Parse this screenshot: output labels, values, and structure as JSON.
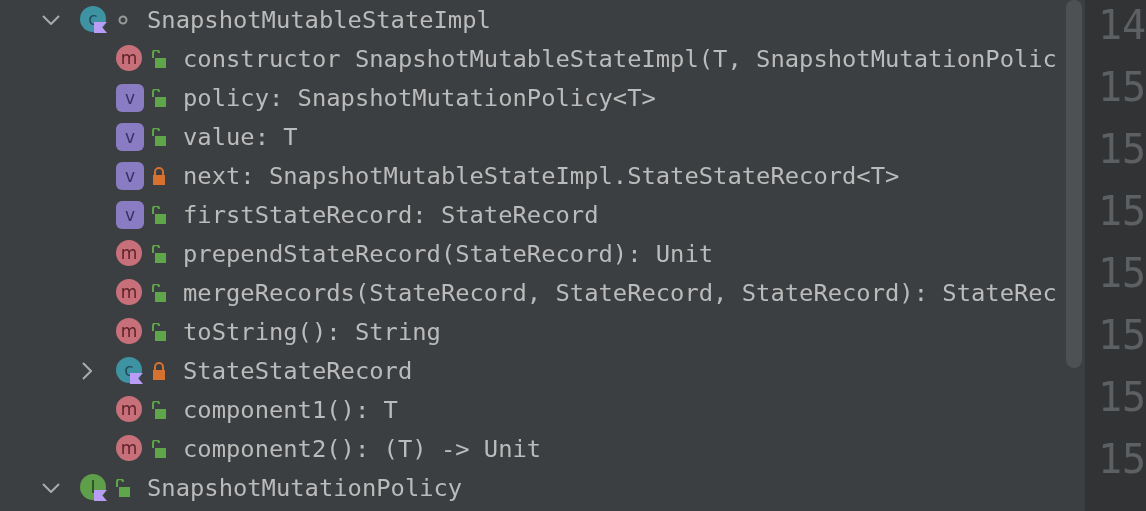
{
  "structure_tree": [
    {
      "kind": "class",
      "badge": "c",
      "package_private": true,
      "expanded": true,
      "label": "SnapshotMutableStateImpl",
      "children": [
        {
          "kind": "method",
          "badge": "m",
          "locked": false,
          "label": "constructor SnapshotMutableStateImpl(T, SnapshotMutationPolic"
        },
        {
          "kind": "variable",
          "badge": "v",
          "locked": false,
          "label": "policy: SnapshotMutationPolicy<T>"
        },
        {
          "kind": "variable",
          "badge": "v",
          "locked": false,
          "label": "value: T"
        },
        {
          "kind": "variable",
          "badge": "v",
          "locked": true,
          "label": "next: SnapshotMutableStateImpl.StateStateRecord<T>"
        },
        {
          "kind": "variable",
          "badge": "v",
          "locked": false,
          "label": "firstStateRecord: StateRecord"
        },
        {
          "kind": "method",
          "badge": "m",
          "locked": false,
          "label": "prependStateRecord(StateRecord): Unit"
        },
        {
          "kind": "method",
          "badge": "m",
          "locked": false,
          "label": "mergeRecords(StateRecord, StateRecord, StateRecord): StateRec"
        },
        {
          "kind": "method",
          "badge": "m",
          "locked": false,
          "label": "toString(): String"
        },
        {
          "kind": "class",
          "badge": "c",
          "locked": true,
          "expanded": false,
          "label": "StateStateRecord"
        },
        {
          "kind": "method",
          "badge": "m",
          "locked": false,
          "label": "component1(): T"
        },
        {
          "kind": "method",
          "badge": "m",
          "locked": false,
          "label": "component2(): (T) -> Unit"
        }
      ]
    },
    {
      "kind": "interface",
      "badge": "I",
      "locked": false,
      "expanded": true,
      "label": "SnapshotMutationPolicy"
    }
  ],
  "gutter_line_numbers": [
    "14",
    "15",
    "15",
    "15",
    "15",
    "15",
    "15",
    "15"
  ]
}
